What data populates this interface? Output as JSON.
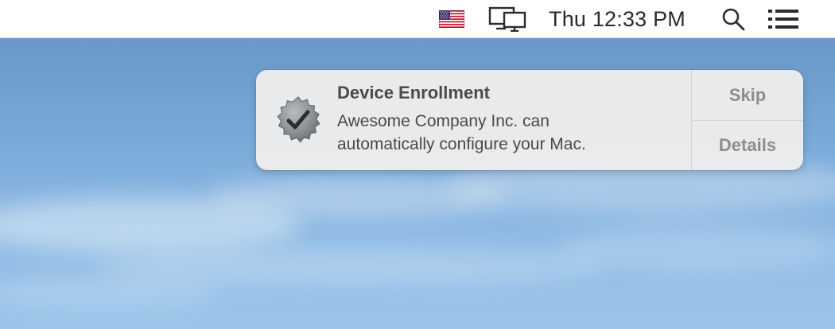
{
  "menubar": {
    "flag_icon": "us-flag-icon",
    "display_icon": "airplay-display-icon",
    "clock": "Thu 12:33 PM",
    "search_icon": "spotlight-search-icon",
    "notification_center_icon": "list-icon"
  },
  "notification": {
    "icon": "verified-badge-icon",
    "title": "Device Enrollment",
    "body_line1": "Awesome Company Inc. can",
    "body_line2": "automatically configure your Mac.",
    "actions": {
      "skip": "Skip",
      "details": "Details"
    }
  },
  "colors": {
    "menubar_bg": "#ffffff",
    "notification_bg": "#ececec",
    "action_text": "#8e8e8e",
    "sky": "#79a9d8"
  }
}
